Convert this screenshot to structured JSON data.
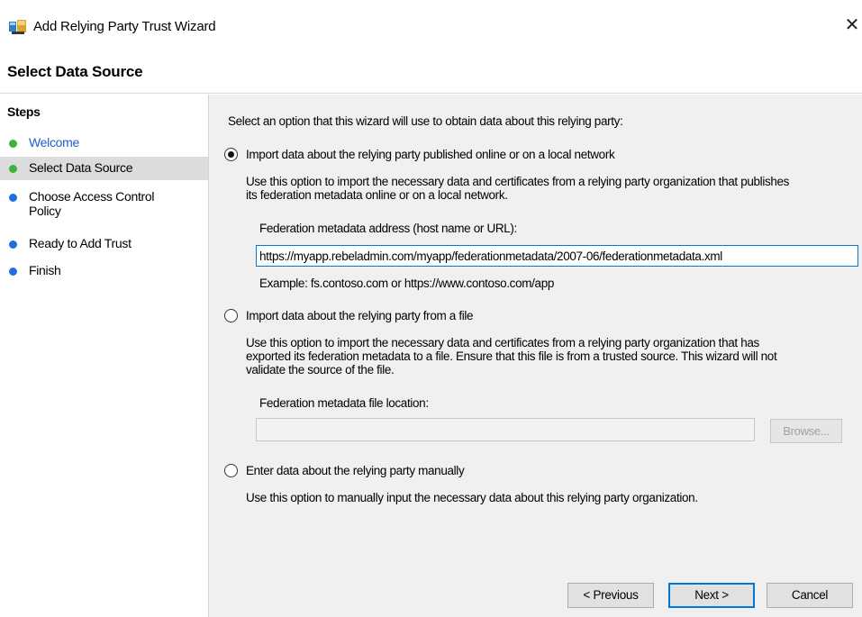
{
  "window": {
    "title": "Add Relying Party Trust Wizard",
    "close_glyph": "✕",
    "app_icon": "adfs-wizard-icon"
  },
  "page": {
    "title": "Select Data Source"
  },
  "sidebar": {
    "title": "Steps",
    "items": [
      {
        "label": "Welcome",
        "dot_color": "#3cb43c",
        "link": true,
        "current": false
      },
      {
        "label": "Select Data Source",
        "dot_color": "#3cb43c",
        "link": false,
        "current": true
      },
      {
        "label": "Choose Access Control\nPolicy",
        "dot_color": "#1f6fe0",
        "link": false,
        "current": false
      },
      {
        "label": "Ready to Add Trust",
        "dot_color": "#1f6fe0",
        "link": false,
        "current": false
      },
      {
        "label": "Finish",
        "dot_color": "#1f6fe0",
        "link": false,
        "current": false
      }
    ]
  },
  "main": {
    "intro": "Select an option that this wizard will use to obtain data about this relying party:",
    "options": [
      {
        "label": "Import data about the relying party published online or on a local network",
        "selected": true,
        "description_lines": [
          "Use this option to import the necessary data and certificates from a relying party organization that publishes",
          "its federation metadata online or on a local network."
        ],
        "field_label": "Federation metadata address (host name or URL):",
        "field_value": "https://myapp.rebeladmin.com/myapp/federationmetadata/2007-06/federationmetadata.xml",
        "example": "Example: fs.contoso.com or https://www.contoso.com/app"
      },
      {
        "label": "Import data about the relying party from a file",
        "selected": false,
        "description_lines": [
          "Use this option to import the necessary data and certificates from a relying party organization that has",
          "exported its federation metadata to a file. Ensure that this file is from a trusted source.  This wizard will not",
          "validate the source of the file."
        ],
        "field_label": "Federation metadata file location:",
        "field_value": "",
        "browse_label": "Browse..."
      },
      {
        "label": "Enter data about the relying party manually",
        "selected": false,
        "description_lines": [
          "Use this option to manually input the necessary data about this relying party organization."
        ]
      }
    ]
  },
  "footer": {
    "previous_label": "< Previous",
    "next_label": "Next >",
    "cancel_label": "Cancel"
  },
  "colors": {
    "accent": "#0078d7",
    "link": "#1f5fcf",
    "panel_bg": "#f0f0f0",
    "selected_step_bg": "#dcdcdc"
  }
}
